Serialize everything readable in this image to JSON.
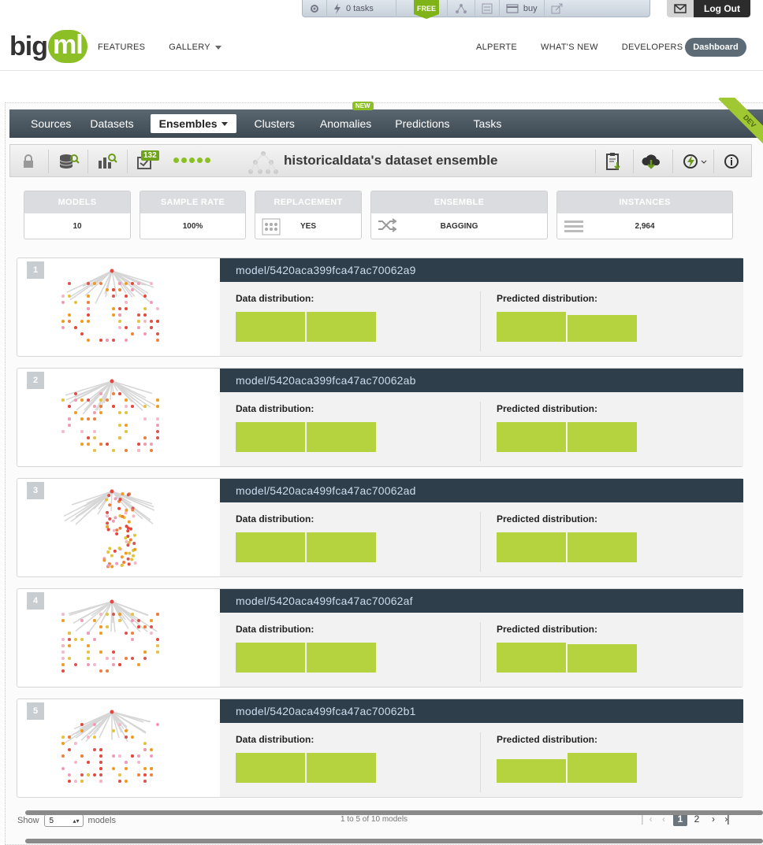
{
  "topbar": {
    "tasks_label": "0 tasks",
    "free_label": "FREE",
    "buy_label": "buy",
    "logout_label": "Log Out"
  },
  "header": {
    "logo_big": "big",
    "logo_ml": "ml",
    "nav_left": [
      "FEATURES",
      "GALLERY"
    ],
    "nav_right": [
      "ALPERTE",
      "WHAT'S NEW",
      "DEVELOPERS"
    ],
    "dashboard_label": "Dashboard"
  },
  "main_nav": {
    "tabs": [
      "Sources",
      "Datasets",
      "Ensembles",
      "Clusters",
      "Anomalies",
      "Predictions",
      "Tasks"
    ],
    "new_badge": "NEW",
    "dev_ribbon": "DEV"
  },
  "toolbar": {
    "count_badge": "132",
    "title": "historicaldata's dataset ensemble"
  },
  "stats": [
    {
      "label": "MODELS",
      "value": "10"
    },
    {
      "label": "SAMPLE RATE",
      "value": "100%"
    },
    {
      "label": "REPLACEMENT",
      "value": "YES"
    },
    {
      "label": "ENSEMBLE",
      "value": "BAGGING"
    },
    {
      "label": "INSTANCES",
      "value": "2,964"
    }
  ],
  "dist_labels": {
    "data": "Data distribution:",
    "predicted": "Predicted distribution:"
  },
  "models": [
    {
      "num": "1",
      "id": "model/5420aca399fca47ac70062a9",
      "data_dist": [
        1.0,
        1.0
      ],
      "pred_dist": [
        1.0,
        0.9
      ]
    },
    {
      "num": "2",
      "id": "model/5420aca399fca47ac70062ab",
      "data_dist": [
        1.0,
        1.0
      ],
      "pred_dist": [
        1.0,
        1.0
      ]
    },
    {
      "num": "3",
      "id": "model/5420aca499fca47ac70062ad",
      "data_dist": [
        1.0,
        1.0
      ],
      "pred_dist": [
        1.0,
        1.0
      ]
    },
    {
      "num": "4",
      "id": "model/5420aca499fca47ac70062af",
      "data_dist": [
        1.0,
        1.0
      ],
      "pred_dist": [
        1.0,
        0.95
      ]
    },
    {
      "num": "5",
      "id": "model/5420aca499fca47ac70062b1",
      "data_dist": [
        1.0,
        1.0
      ],
      "pred_dist": [
        0.8,
        1.0
      ]
    }
  ],
  "footer": {
    "show_label": "Show",
    "page_size": "5",
    "models_label": "models",
    "range": "1 to 5 of 10 models",
    "pages": [
      "1",
      "2"
    ]
  },
  "colors": {
    "accent_green": "#8cbf26",
    "bar_green": "#b5d33f",
    "model_header": "#2e3e4a",
    "nav_bg": "#46525b"
  }
}
